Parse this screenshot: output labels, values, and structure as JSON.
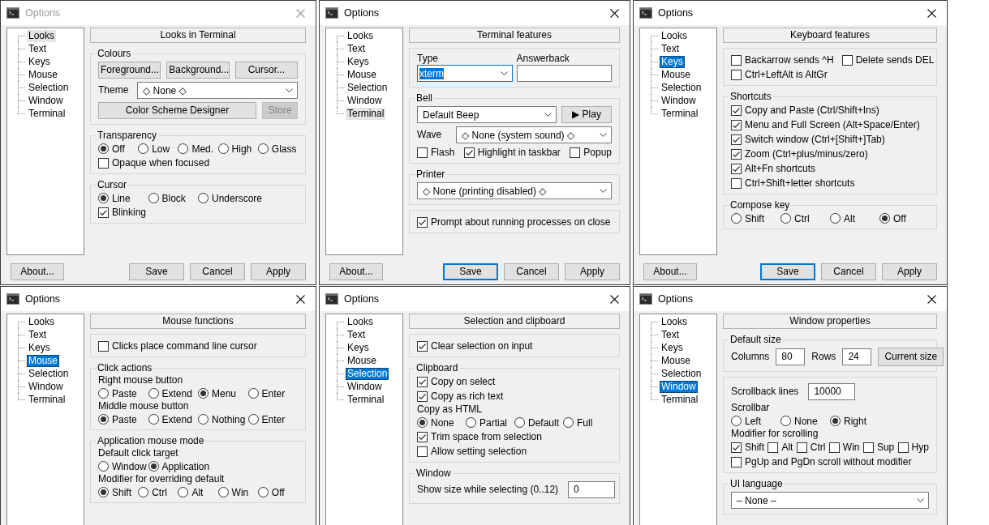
{
  "windows": [
    {
      "title": "Options",
      "active": false,
      "tree_focused": false,
      "tree": [
        {
          "label": "Looks",
          "selected": true
        },
        {
          "label": "Text",
          "selected": false
        },
        {
          "label": "Keys",
          "selected": false
        },
        {
          "label": "Mouse",
          "selected": false
        },
        {
          "label": "Selection",
          "selected": false
        },
        {
          "label": "Window",
          "selected": false
        },
        {
          "label": "Terminal",
          "selected": false
        }
      ],
      "heading": "Looks in Terminal",
      "groups": [
        {
          "title": "Colours",
          "rows": [
            {
              "kind": "buttons",
              "buttons": [
                {
                  "label": "Foreground...",
                  "disabled": false
                },
                {
                  "label": "Background...",
                  "disabled": false
                },
                {
                  "label": "Cursor...",
                  "disabled": false
                }
              ]
            },
            {
              "kind": "select",
              "label": "Theme",
              "value": "◇ None ◇"
            },
            {
              "kind": "button_with_side",
              "main": {
                "label": "Color Scheme Designer",
                "disabled": false
              },
              "side": {
                "label": "Store",
                "disabled": true
              }
            }
          ]
        },
        {
          "title": "Transparency",
          "rows": [
            {
              "kind": "radios",
              "items": [
                {
                  "label": "Off",
                  "selected": true
                },
                {
                  "label": "Low",
                  "selected": false
                },
                {
                  "label": "Med.",
                  "selected": false
                },
                {
                  "label": "High",
                  "selected": false
                },
                {
                  "label": "Glass",
                  "selected": false
                }
              ]
            },
            {
              "kind": "checks",
              "items": [
                {
                  "label": "Opaque when focused",
                  "checked": false
                }
              ]
            }
          ]
        },
        {
          "title": "Cursor",
          "rows": [
            {
              "kind": "radios",
              "items": [
                {
                  "label": "Line",
                  "selected": true
                },
                {
                  "label": "Block",
                  "selected": false
                },
                {
                  "label": "Underscore",
                  "selected": false
                }
              ]
            },
            {
              "kind": "checks",
              "items": [
                {
                  "label": "Blinking",
                  "checked": true
                }
              ]
            }
          ]
        }
      ],
      "buttons": [
        {
          "label": "About...",
          "default": false
        },
        {
          "label": "Save",
          "default": false
        },
        {
          "label": "Cancel",
          "default": false
        },
        {
          "label": "Apply",
          "default": false
        }
      ]
    },
    {
      "title": "Options",
      "active": true,
      "tree_focused": false,
      "tree": [
        {
          "label": "Looks",
          "selected": false
        },
        {
          "label": "Text",
          "selected": false
        },
        {
          "label": "Keys",
          "selected": false
        },
        {
          "label": "Mouse",
          "selected": false
        },
        {
          "label": "Selection",
          "selected": false
        },
        {
          "label": "Window",
          "selected": false
        },
        {
          "label": "Terminal",
          "selected": true
        }
      ],
      "heading": "Terminal features",
      "groups": [
        {
          "rows": [
            {
              "kind": "labeled_fields",
              "fields": [
                {
                  "kind": "combo",
                  "label": "Type",
                  "value": "xterm",
                  "focused": true
                },
                {
                  "kind": "input",
                  "label": "Answerback",
                  "focused": false
                }
              ]
            }
          ]
        },
        {
          "title": "Bell",
          "rows": [
            {
              "kind": "combo_button",
              "value": "Default Beep",
              "button": {
                "label": "▶ Play",
                "disabled": false
              }
            },
            {
              "kind": "select",
              "label": "Wave",
              "value": "◇ None (system sound) ◇"
            },
            {
              "kind": "checks",
              "items": [
                {
                  "label": "Flash",
                  "checked": false
                },
                {
                  "label": "Highlight in taskbar",
                  "checked": true
                },
                {
                  "label": "Popup",
                  "checked": false
                }
              ]
            }
          ]
        },
        {
          "title": "Printer",
          "rows": [
            {
              "kind": "combo",
              "value": "◇ None (printing disabled) ◇"
            }
          ]
        },
        {
          "rows": [
            {
              "kind": "checks",
              "items": [
                {
                  "label": "Prompt about running processes on close",
                  "checked": true
                }
              ]
            }
          ]
        }
      ],
      "buttons": [
        {
          "label": "About...",
          "default": false
        },
        {
          "label": "Save",
          "default": true
        },
        {
          "label": "Cancel",
          "default": false
        },
        {
          "label": "Apply",
          "default": false
        }
      ]
    },
    {
      "title": "Options",
      "active": true,
      "tree_focused": true,
      "tree": [
        {
          "label": "Looks",
          "selected": false
        },
        {
          "label": "Text",
          "selected": false
        },
        {
          "label": "Keys",
          "selected": true
        },
        {
          "label": "Mouse",
          "selected": false
        },
        {
          "label": "Selection",
          "selected": false
        },
        {
          "label": "Window",
          "selected": false
        },
        {
          "label": "Terminal",
          "selected": false
        }
      ],
      "heading": "Keyboard features",
      "groups": [
        {
          "rows": [
            {
              "kind": "checks",
              "items": [
                {
                  "label": "Backarrow sends ^H",
                  "checked": false
                },
                {
                  "label": "Delete sends DEL",
                  "checked": false
                }
              ]
            },
            {
              "kind": "checks",
              "items": [
                {
                  "label": "Ctrl+LeftAlt is AltGr",
                  "checked": false
                }
              ]
            }
          ]
        },
        {
          "title": "Shortcuts",
          "rows": [
            {
              "kind": "checks",
              "items": [
                {
                  "label": "Copy and Paste (Ctrl/Shift+Ins)",
                  "checked": true
                }
              ]
            },
            {
              "kind": "checks",
              "items": [
                {
                  "label": "Menu and Full Screen (Alt+Space/Enter)",
                  "checked": true
                }
              ]
            },
            {
              "kind": "checks",
              "items": [
                {
                  "label": "Switch window (Ctrl+[Shift+]Tab)",
                  "checked": true
                }
              ]
            },
            {
              "kind": "checks",
              "items": [
                {
                  "label": "Zoom (Ctrl+plus/minus/zero)",
                  "checked": true
                }
              ]
            },
            {
              "kind": "checks",
              "items": [
                {
                  "label": "Alt+Fn shortcuts",
                  "checked": true
                }
              ]
            },
            {
              "kind": "checks",
              "items": [
                {
                  "label": "Ctrl+Shift+letter shortcuts",
                  "checked": false
                }
              ]
            }
          ]
        },
        {
          "title": "Compose key",
          "rows": [
            {
              "kind": "radios",
              "items": [
                {
                  "label": "Shift",
                  "selected": false
                },
                {
                  "label": "Ctrl",
                  "selected": false
                },
                {
                  "label": "Alt",
                  "selected": false
                },
                {
                  "label": "Off",
                  "selected": true
                }
              ]
            }
          ]
        }
      ],
      "buttons": [
        {
          "label": "About...",
          "default": false
        },
        {
          "label": "Save",
          "default": true
        },
        {
          "label": "Cancel",
          "default": false
        },
        {
          "label": "Apply",
          "default": false
        }
      ]
    },
    {
      "title": "Options",
      "active": true,
      "tree_focused": true,
      "tree": [
        {
          "label": "Looks",
          "selected": false
        },
        {
          "label": "Text",
          "selected": false
        },
        {
          "label": "Keys",
          "selected": false
        },
        {
          "label": "Mouse",
          "selected": true
        },
        {
          "label": "Selection",
          "selected": false
        },
        {
          "label": "Window",
          "selected": false
        },
        {
          "label": "Terminal",
          "selected": false
        }
      ],
      "heading": "Mouse functions",
      "groups": [
        {
          "rows": [
            {
              "kind": "checks",
              "items": [
                {
                  "label": "Clicks place command line cursor",
                  "checked": false
                }
              ]
            }
          ]
        },
        {
          "title": "Click actions",
          "rows": [
            {
              "kind": "radios",
              "label": "Right mouse button",
              "items": [
                {
                  "label": "Paste",
                  "selected": false
                },
                {
                  "label": "Extend",
                  "selected": false
                },
                {
                  "label": "Menu",
                  "selected": true
                },
                {
                  "label": "Enter",
                  "selected": false
                }
              ]
            },
            {
              "kind": "radios",
              "label": "Middle mouse button",
              "items": [
                {
                  "label": "Paste",
                  "selected": true
                },
                {
                  "label": "Extend",
                  "selected": false
                },
                {
                  "label": "Nothing",
                  "selected": false
                },
                {
                  "label": "Enter",
                  "selected": false
                }
              ]
            }
          ]
        },
        {
          "title": "Application mouse mode",
          "rows": [
            {
              "kind": "radios",
              "label": "Default click target",
              "items": [
                {
                  "label": "Window",
                  "selected": false
                },
                {
                  "label": "Application",
                  "selected": true
                }
              ]
            },
            {
              "kind": "radios",
              "label": "Modifier for overriding default",
              "items": [
                {
                  "label": "Shift",
                  "selected": true
                },
                {
                  "label": "Ctrl",
                  "selected": false
                },
                {
                  "label": "Alt",
                  "selected": false
                },
                {
                  "label": "Win",
                  "selected": false
                },
                {
                  "label": "Off",
                  "selected": false
                }
              ]
            }
          ]
        }
      ]
    },
    {
      "title": "Options",
      "active": true,
      "tree_focused": true,
      "tree": [
        {
          "label": "Looks",
          "selected": false
        },
        {
          "label": "Text",
          "selected": false
        },
        {
          "label": "Keys",
          "selected": false
        },
        {
          "label": "Mouse",
          "selected": false
        },
        {
          "label": "Selection",
          "selected": true
        },
        {
          "label": "Window",
          "selected": false
        },
        {
          "label": "Terminal",
          "selected": false
        }
      ],
      "heading": "Selection and clipboard",
      "groups": [
        {
          "rows": [
            {
              "kind": "checks",
              "items": [
                {
                  "label": "Clear selection on input",
                  "checked": true
                }
              ]
            }
          ]
        },
        {
          "title": "Clipboard",
          "rows": [
            {
              "kind": "checks",
              "items": [
                {
                  "label": "Copy on select",
                  "checked": true
                }
              ]
            },
            {
              "kind": "checks",
              "items": [
                {
                  "label": "Copy as rich text",
                  "checked": true
                }
              ]
            },
            {
              "kind": "radios",
              "label": "Copy as HTML",
              "items": [
                {
                  "label": "None",
                  "selected": true
                },
                {
                  "label": "Partial",
                  "selected": false
                },
                {
                  "label": "Default",
                  "selected": false
                },
                {
                  "label": "Full",
                  "selected": false
                }
              ]
            },
            {
              "kind": "checks",
              "items": [
                {
                  "label": "Trim space from selection",
                  "checked": true
                }
              ]
            },
            {
              "kind": "checks",
              "items": [
                {
                  "label": "Allow setting selection",
                  "checked": false
                }
              ]
            }
          ]
        },
        {
          "title": "Window",
          "rows": [
            {
              "kind": "field",
              "label": "Show size while selecting (0..12)",
              "value": "0"
            }
          ]
        }
      ]
    },
    {
      "title": "Options",
      "active": true,
      "tree_focused": true,
      "tree": [
        {
          "label": "Looks",
          "selected": false
        },
        {
          "label": "Text",
          "selected": false
        },
        {
          "label": "Keys",
          "selected": false
        },
        {
          "label": "Mouse",
          "selected": false
        },
        {
          "label": "Selection",
          "selected": false
        },
        {
          "label": "Window",
          "selected": true
        },
        {
          "label": "Terminal",
          "selected": false
        }
      ],
      "heading": "Window properties",
      "groups": [
        {
          "title": "Default size",
          "rows": [
            {
              "kind": "size_fields",
              "fields": [
                {
                  "label": "Columns",
                  "value": "80"
                },
                {
                  "label": "Rows",
                  "value": "24"
                }
              ],
              "button": {
                "label": "Current size",
                "disabled": false
              }
            }
          ]
        },
        {
          "rows": [
            {
              "kind": "field",
              "label": "Scrollback lines",
              "value": "10000"
            },
            {
              "kind": "radios",
              "label": "Scrollbar",
              "items": [
                {
                  "label": "Left",
                  "selected": false
                },
                {
                  "label": "None",
                  "selected": false
                },
                {
                  "label": "Right",
                  "selected": true
                }
              ]
            },
            {
              "kind": "checks",
              "label": "Modifier for scrolling",
              "items": [
                {
                  "label": "Shift",
                  "checked": true
                },
                {
                  "label": "Alt",
                  "checked": false
                },
                {
                  "label": "Ctrl",
                  "checked": false
                },
                {
                  "label": "Win",
                  "checked": false
                },
                {
                  "label": "Sup",
                  "checked": false
                },
                {
                  "label": "Hyp",
                  "checked": false
                }
              ]
            },
            {
              "kind": "checks",
              "items": [
                {
                  "label": "PgUp and PgDn scroll without modifier",
                  "checked": false
                }
              ]
            }
          ]
        },
        {
          "title": "UI language",
          "rows": [
            {
              "kind": "combo",
              "value": "– None –"
            }
          ]
        }
      ]
    }
  ]
}
